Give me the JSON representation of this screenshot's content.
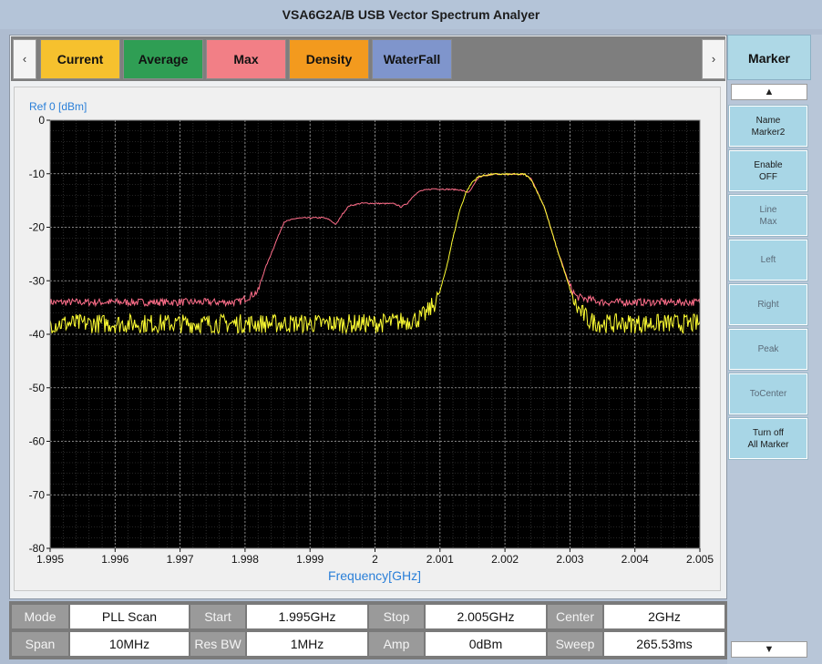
{
  "window": {
    "title": "VSA6G2A/B USB Vector Spectrum Analyer"
  },
  "tabs": {
    "left_arrow": "‹",
    "right_arrow": "›",
    "items": [
      {
        "label": "Current",
        "color": "#f6c12e"
      },
      {
        "label": "Average",
        "color": "#2f9e54"
      },
      {
        "label": "Max",
        "color": "#f27f86"
      },
      {
        "label": "Density",
        "color": "#f39a1e"
      },
      {
        "label": "WaterFall",
        "color": "#7f95cc"
      }
    ]
  },
  "chart_data": {
    "type": "line",
    "ref_label": "Ref  0 [dBm]",
    "xlabel": "Frequency[GHz]",
    "xlim": [
      1.995,
      2.005
    ],
    "ylim": [
      -80,
      0
    ],
    "xticks": [
      1.995,
      1.996,
      1.997,
      1.998,
      1.999,
      2,
      2.001,
      2.002,
      2.003,
      2.004,
      2.005
    ],
    "xtick_labels": [
      "1.995",
      "1.996",
      "1.997",
      "1.998",
      "1.999",
      "2",
      "2.001",
      "2.002",
      "2.003",
      "2.004",
      "2.005"
    ],
    "yticks": [
      0,
      -10,
      -20,
      -30,
      -40,
      -50,
      -60,
      -70,
      -80
    ],
    "ytick_labels": [
      "0",
      "-10",
      "-20",
      "-30",
      "-40",
      "-50",
      "-60",
      "-70",
      "-80"
    ],
    "grid": true,
    "background": "#000000",
    "series": [
      {
        "color": "#ff6e8a",
        "points": [
          [
            1.995,
            -34
          ],
          [
            1.996,
            -34
          ],
          [
            1.997,
            -34
          ],
          [
            1.9979,
            -34
          ],
          [
            1.9982,
            -32
          ],
          [
            1.9983,
            -28
          ],
          [
            1.9985,
            -22
          ],
          [
            1.9986,
            -19
          ],
          [
            1.9988,
            -18.3
          ],
          [
            1.9992,
            -18.2
          ],
          [
            1.9993,
            -18.6
          ],
          [
            1.9994,
            -19.5
          ],
          [
            1.9995,
            -17.5
          ],
          [
            1.9996,
            -16
          ],
          [
            1.9998,
            -15.5
          ],
          [
            2.0003,
            -15.6
          ],
          [
            2.0004,
            -16.2
          ],
          [
            2.0005,
            -15.5
          ],
          [
            2.0006,
            -14
          ],
          [
            2.0007,
            -13.2
          ],
          [
            2.0009,
            -12.8
          ],
          [
            2.0013,
            -13
          ],
          [
            2.00145,
            -13.5
          ],
          [
            2.0015,
            -12.5
          ],
          [
            2.0016,
            -10.6
          ],
          [
            2.0018,
            -10.1
          ],
          [
            2.0023,
            -10.1
          ],
          [
            2.0024,
            -10.8
          ],
          [
            2.0026,
            -16
          ],
          [
            2.0028,
            -24
          ],
          [
            2.003,
            -31
          ],
          [
            2.0031,
            -33
          ],
          [
            2.0035,
            -34
          ],
          [
            2.005,
            -34
          ]
        ]
      },
      {
        "color": "#ffff33",
        "points": [
          [
            1.995,
            -38
          ],
          [
            1.996,
            -38
          ],
          [
            1.997,
            -38
          ],
          [
            1.998,
            -38
          ],
          [
            1.999,
            -38
          ],
          [
            2.0,
            -38
          ],
          [
            2.0005,
            -37.5
          ],
          [
            2.0007,
            -37
          ],
          [
            2.0008,
            -36
          ],
          [
            2.0009,
            -34.5
          ],
          [
            2.001,
            -32
          ],
          [
            2.0011,
            -27.5
          ],
          [
            2.0012,
            -22
          ],
          [
            2.0013,
            -17
          ],
          [
            2.0014,
            -13.5
          ],
          [
            2.0015,
            -11.5
          ],
          [
            2.0016,
            -10.5
          ],
          [
            2.0018,
            -10.1
          ],
          [
            2.0023,
            -10.1
          ],
          [
            2.0024,
            -11
          ],
          [
            2.0026,
            -16
          ],
          [
            2.0028,
            -24
          ],
          [
            2.003,
            -31.5
          ],
          [
            2.0031,
            -35
          ],
          [
            2.0033,
            -37.5
          ],
          [
            2.0035,
            -38
          ],
          [
            2.005,
            -38
          ]
        ]
      }
    ]
  },
  "status": {
    "row1": [
      {
        "label": "Mode",
        "value": "PLL Scan"
      },
      {
        "label": "Start",
        "value": "1.995GHz"
      },
      {
        "label": "Stop",
        "value": "2.005GHz"
      },
      {
        "label": "Center",
        "value": "2GHz"
      }
    ],
    "row2": [
      {
        "label": "Span",
        "value": "10MHz"
      },
      {
        "label": "Res BW",
        "value": "1MHz"
      },
      {
        "label": "Amp",
        "value": "0dBm"
      },
      {
        "label": "Sweep",
        "value": "265.53ms"
      }
    ]
  },
  "marker_panel": {
    "title": "Marker",
    "scroll_up": "▲",
    "scroll_down": "▼",
    "buttons": [
      {
        "line1": "Name",
        "line2": "Marker2"
      },
      {
        "line1": "Enable",
        "line2": "OFF"
      },
      {
        "line1": "Line",
        "line2": "Max"
      },
      {
        "line1": "Left",
        "line2": ""
      },
      {
        "line1": "Right",
        "line2": ""
      },
      {
        "line1": "Peak",
        "line2": ""
      },
      {
        "line1": "ToCenter",
        "line2": ""
      },
      {
        "line1": "Turn off",
        "line2": "All Marker"
      }
    ]
  }
}
